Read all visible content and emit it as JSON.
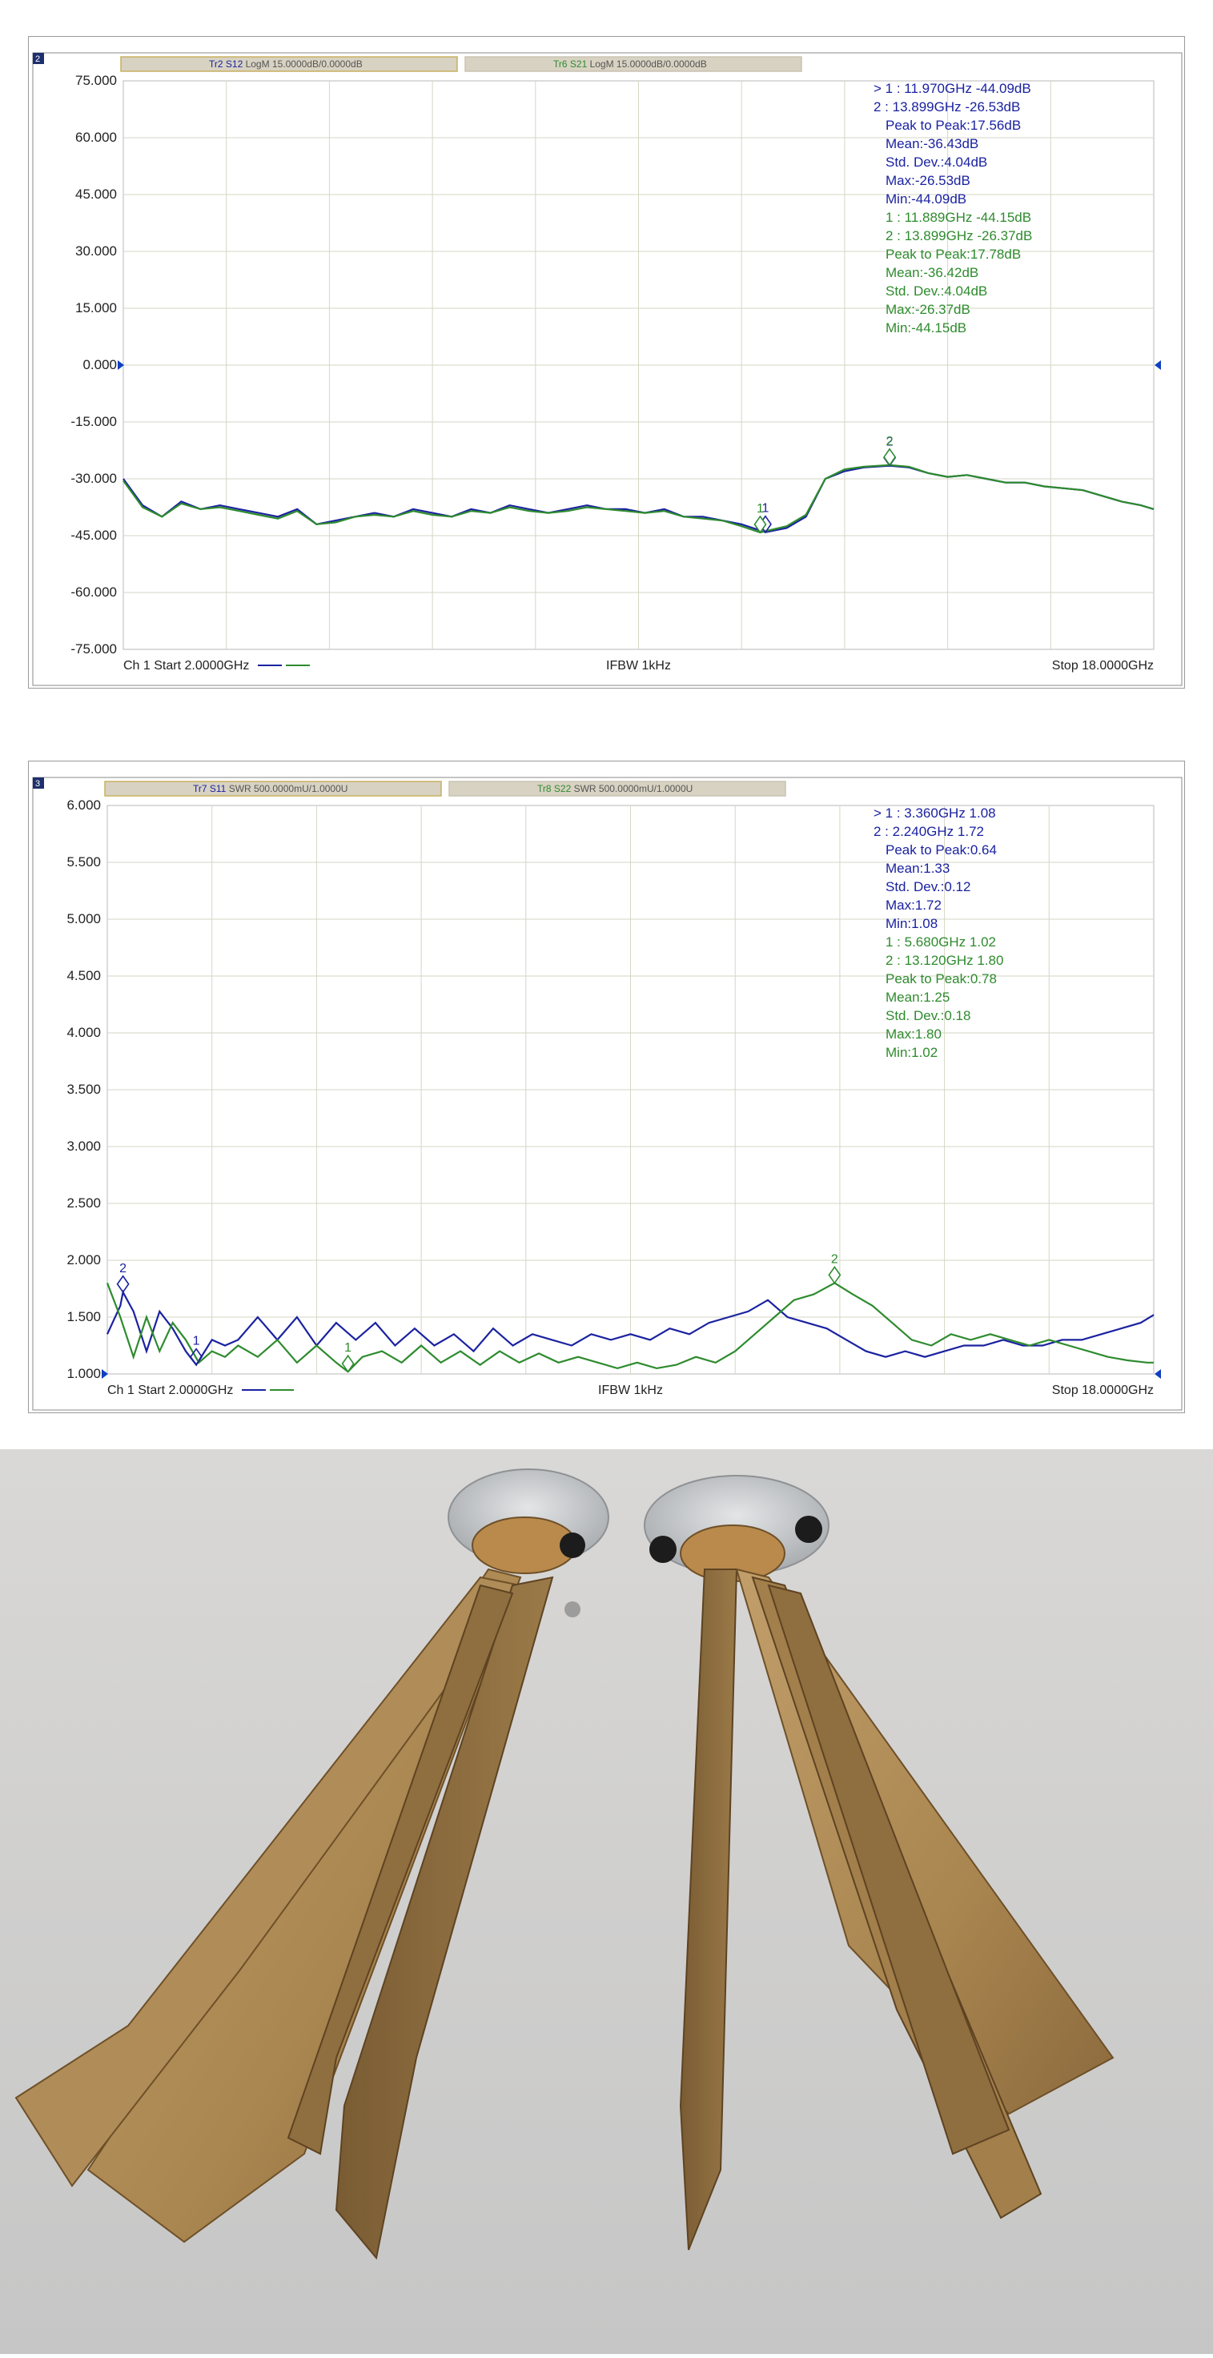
{
  "colors": {
    "trace_a": "#1a22a0",
    "trace_b": "#2e8b2e",
    "grid": "#d6d6c4",
    "frame": "#8a8a8a",
    "tab_bg": "#d8d2c2",
    "tab_border": "#c9b060",
    "marker_blue": "#1a22a0",
    "marker_green": "#2e8b2e",
    "bronze_light": "#b5925f",
    "bronze_dark": "#7d5f37",
    "mount_gray": "#c9cbcd"
  },
  "chart_data": [
    {
      "type": "line",
      "window_number": "2",
      "tabs": [
        {
          "trace": "Tr2 S12",
          "format": "LogM 15.0000dB/0.0000dB",
          "color": "blue"
        },
        {
          "trace": "Tr6 S21",
          "format": "LogM 15.0000dB/0.0000dB",
          "color": "green"
        }
      ],
      "ylim": [
        -75,
        75
      ],
      "xlim": [
        2,
        18
      ],
      "yticks": [
        "75.000",
        "60.000",
        "45.000",
        "30.000",
        "15.000",
        "0.000",
        "-15.000",
        "-30.000",
        "-45.000",
        "-60.000",
        "-75.000"
      ],
      "reference_level": 0,
      "footer": {
        "left": "Ch 1 Start 2.0000GHz",
        "center": "IFBW 1kHz",
        "right": "Stop 18.0000GHz"
      },
      "series": [
        {
          "color": "blue",
          "x": [
            2.0,
            2.3,
            2.6,
            2.9,
            3.2,
            3.5,
            3.8,
            4.1,
            4.4,
            4.7,
            5.0,
            5.3,
            5.6,
            5.9,
            6.2,
            6.5,
            6.8,
            7.1,
            7.4,
            7.7,
            8.0,
            8.3,
            8.6,
            8.9,
            9.2,
            9.5,
            9.8,
            10.1,
            10.4,
            10.7,
            11.0,
            11.3,
            11.6,
            11.97,
            12.3,
            12.6,
            12.9,
            13.2,
            13.5,
            13.899,
            14.2,
            14.5,
            14.8,
            15.1,
            15.4,
            15.7,
            16.0,
            16.3,
            16.6,
            16.9,
            17.2,
            17.5,
            17.8,
            18.0
          ],
          "y": [
            -30,
            -37,
            -40,
            -36,
            -38,
            -37,
            -38,
            -39,
            -40,
            -38,
            -42,
            -41,
            -40,
            -39,
            -40,
            -38,
            -39,
            -40,
            -38,
            -39,
            -37,
            -38,
            -39,
            -38,
            -37,
            -38,
            -38,
            -39,
            -38,
            -40,
            -40,
            -41,
            -42,
            -44.09,
            -43,
            -40,
            -30,
            -28,
            -27,
            -26.53,
            -27,
            -28.5,
            -29.5,
            -29,
            -30,
            -31,
            -31,
            -32,
            -32.5,
            -33,
            -34.5,
            -36,
            -37,
            -38
          ]
        },
        {
          "color": "green",
          "x": [
            2.0,
            2.3,
            2.6,
            2.9,
            3.2,
            3.5,
            3.8,
            4.1,
            4.4,
            4.7,
            5.0,
            5.3,
            5.6,
            5.9,
            6.2,
            6.5,
            6.8,
            7.1,
            7.4,
            7.7,
            8.0,
            8.3,
            8.6,
            8.9,
            9.2,
            9.5,
            9.8,
            10.1,
            10.4,
            10.7,
            11.0,
            11.3,
            11.6,
            11.889,
            12.3,
            12.6,
            12.9,
            13.2,
            13.5,
            13.899,
            14.2,
            14.5,
            14.8,
            15.1,
            15.4,
            15.7,
            16.0,
            16.3,
            16.6,
            16.9,
            17.2,
            17.5,
            17.8,
            18.0
          ],
          "y": [
            -30.5,
            -37.5,
            -40,
            -36.5,
            -38,
            -37.5,
            -38.5,
            -39.5,
            -40.5,
            -38.5,
            -42,
            -41.5,
            -40,
            -39.5,
            -40,
            -38.5,
            -39.5,
            -40,
            -38.5,
            -39,
            -37.5,
            -38.5,
            -39,
            -38.5,
            -37.5,
            -38,
            -38.5,
            -39,
            -38.5,
            -40,
            -40.5,
            -41,
            -42.5,
            -44.15,
            -42.5,
            -39.5,
            -30,
            -27.5,
            -26.8,
            -26.37,
            -26.8,
            -28.5,
            -29.5,
            -29,
            -30,
            -31,
            -31,
            -32,
            -32.5,
            -33,
            -34.5,
            -36,
            -37,
            -38
          ]
        }
      ],
      "markers": [
        {
          "series": 0,
          "label": "1",
          "x": 11.97,
          "y": -44.09
        },
        {
          "series": 0,
          "label": "2",
          "x": 13.899,
          "y": -26.53
        },
        {
          "series": 1,
          "label": "1",
          "x": 11.889,
          "y": -44.15
        },
        {
          "series": 1,
          "label": "2",
          "x": 13.899,
          "y": -26.37
        }
      ],
      "readout_blue": [
        "> 1   : 11.970GHz      -44.09dB",
        "   2   : 13.899GHz      -26.53dB",
        "Peak to Peak:17.56dB",
        "Mean:-36.43dB",
        "Std. Dev.:4.04dB",
        "Max:-26.53dB",
        "Min:-44.09dB"
      ],
      "readout_green": [
        "1   : 11.889GHz      -44.15dB",
        "2   : 13.899GHz      -26.37dB",
        "Peak to Peak:17.78dB",
        "Mean:-36.42dB",
        "Std. Dev.:4.04dB",
        "Max:-26.37dB",
        "Min:-44.15dB"
      ]
    },
    {
      "type": "line",
      "window_number": "3",
      "tabs": [
        {
          "trace": "Tr7 S11",
          "format": "SWR 500.0000mU/1.0000U",
          "color": "blue"
        },
        {
          "trace": "Tr8 S22",
          "format": "SWR 500.0000mU/1.0000U",
          "color": "green"
        }
      ],
      "ylim": [
        1,
        6
      ],
      "xlim": [
        2,
        18
      ],
      "yticks": [
        "6.000",
        "5.500",
        "5.000",
        "4.500",
        "4.000",
        "3.500",
        "3.000",
        "2.500",
        "2.000",
        "1.500",
        "1.000"
      ],
      "reference_level": 1,
      "footer": {
        "left": "Ch 1 Start 2.0000GHz",
        "center": "IFBW 1kHz",
        "right": "Stop 18.0000GHz"
      },
      "series": [
        {
          "color": "blue",
          "x": [
            2.0,
            2.2,
            2.24,
            2.4,
            2.6,
            2.8,
            3.0,
            3.2,
            3.36,
            3.6,
            3.8,
            4.0,
            4.3,
            4.6,
            4.9,
            5.2,
            5.5,
            5.8,
            6.1,
            6.4,
            6.7,
            7.0,
            7.3,
            7.6,
            7.9,
            8.2,
            8.5,
            8.8,
            9.1,
            9.4,
            9.7,
            10.0,
            10.3,
            10.6,
            10.9,
            11.2,
            11.5,
            11.8,
            12.1,
            12.4,
            12.7,
            13.0,
            13.3,
            13.6,
            13.9,
            14.2,
            14.5,
            14.8,
            15.1,
            15.4,
            15.7,
            16.0,
            16.3,
            16.6,
            16.9,
            17.2,
            17.5,
            17.8,
            18.0
          ],
          "y": [
            1.35,
            1.6,
            1.72,
            1.55,
            1.2,
            1.55,
            1.4,
            1.2,
            1.08,
            1.3,
            1.25,
            1.3,
            1.5,
            1.3,
            1.5,
            1.25,
            1.45,
            1.3,
            1.45,
            1.25,
            1.4,
            1.25,
            1.35,
            1.2,
            1.4,
            1.25,
            1.35,
            1.3,
            1.25,
            1.35,
            1.3,
            1.35,
            1.3,
            1.4,
            1.35,
            1.45,
            1.5,
            1.55,
            1.65,
            1.5,
            1.45,
            1.4,
            1.3,
            1.2,
            1.15,
            1.2,
            1.15,
            1.2,
            1.25,
            1.25,
            1.3,
            1.25,
            1.25,
            1.3,
            1.3,
            1.35,
            1.4,
            1.45,
            1.52
          ]
        },
        {
          "color": "green",
          "x": [
            2.0,
            2.2,
            2.4,
            2.6,
            2.8,
            3.0,
            3.2,
            3.4,
            3.6,
            3.8,
            4.0,
            4.3,
            4.6,
            4.9,
            5.2,
            5.5,
            5.68,
            5.9,
            6.2,
            6.5,
            6.8,
            7.1,
            7.4,
            7.7,
            8.0,
            8.3,
            8.6,
            8.9,
            9.2,
            9.5,
            9.8,
            10.1,
            10.4,
            10.7,
            11.0,
            11.3,
            11.6,
            11.9,
            12.2,
            12.5,
            12.8,
            13.12,
            13.4,
            13.7,
            14.0,
            14.3,
            14.6,
            14.9,
            15.2,
            15.5,
            15.8,
            16.1,
            16.4,
            16.7,
            17.0,
            17.3,
            17.6,
            17.9,
            18.0
          ],
          "y": [
            1.8,
            1.5,
            1.15,
            1.5,
            1.2,
            1.45,
            1.3,
            1.1,
            1.2,
            1.15,
            1.25,
            1.15,
            1.3,
            1.1,
            1.25,
            1.1,
            1.02,
            1.15,
            1.2,
            1.1,
            1.25,
            1.1,
            1.2,
            1.08,
            1.2,
            1.1,
            1.18,
            1.1,
            1.15,
            1.1,
            1.05,
            1.1,
            1.05,
            1.08,
            1.15,
            1.1,
            1.2,
            1.35,
            1.5,
            1.65,
            1.7,
            1.8,
            1.7,
            1.6,
            1.45,
            1.3,
            1.25,
            1.35,
            1.3,
            1.35,
            1.3,
            1.25,
            1.3,
            1.25,
            1.2,
            1.15,
            1.12,
            1.1,
            1.1
          ]
        }
      ],
      "markers": [
        {
          "series": 0,
          "label": "1",
          "x": 3.36,
          "y": 1.08
        },
        {
          "series": 0,
          "label": "2",
          "x": 2.24,
          "y": 1.72
        },
        {
          "series": 1,
          "label": "1",
          "x": 5.68,
          "y": 1.02
        },
        {
          "series": 1,
          "label": "2",
          "x": 13.12,
          "y": 1.8
        }
      ],
      "readout_blue": [
        "> 1   : 3.360GHz         1.08",
        "   2   : 2.240GHz         1.72",
        "Peak to Peak:0.64",
        "Mean:1.33",
        "Std. Dev.:0.12",
        "Max:1.72",
        "Min:1.08"
      ],
      "readout_green": [
        "1   : 5.680GHz         1.02",
        "2   : 13.120GHz       1.80",
        "Peak to Peak:0.78",
        "Mean:1.25",
        "Std. Dev.:0.18",
        "Max:1.80",
        "Min:1.02"
      ]
    }
  ]
}
